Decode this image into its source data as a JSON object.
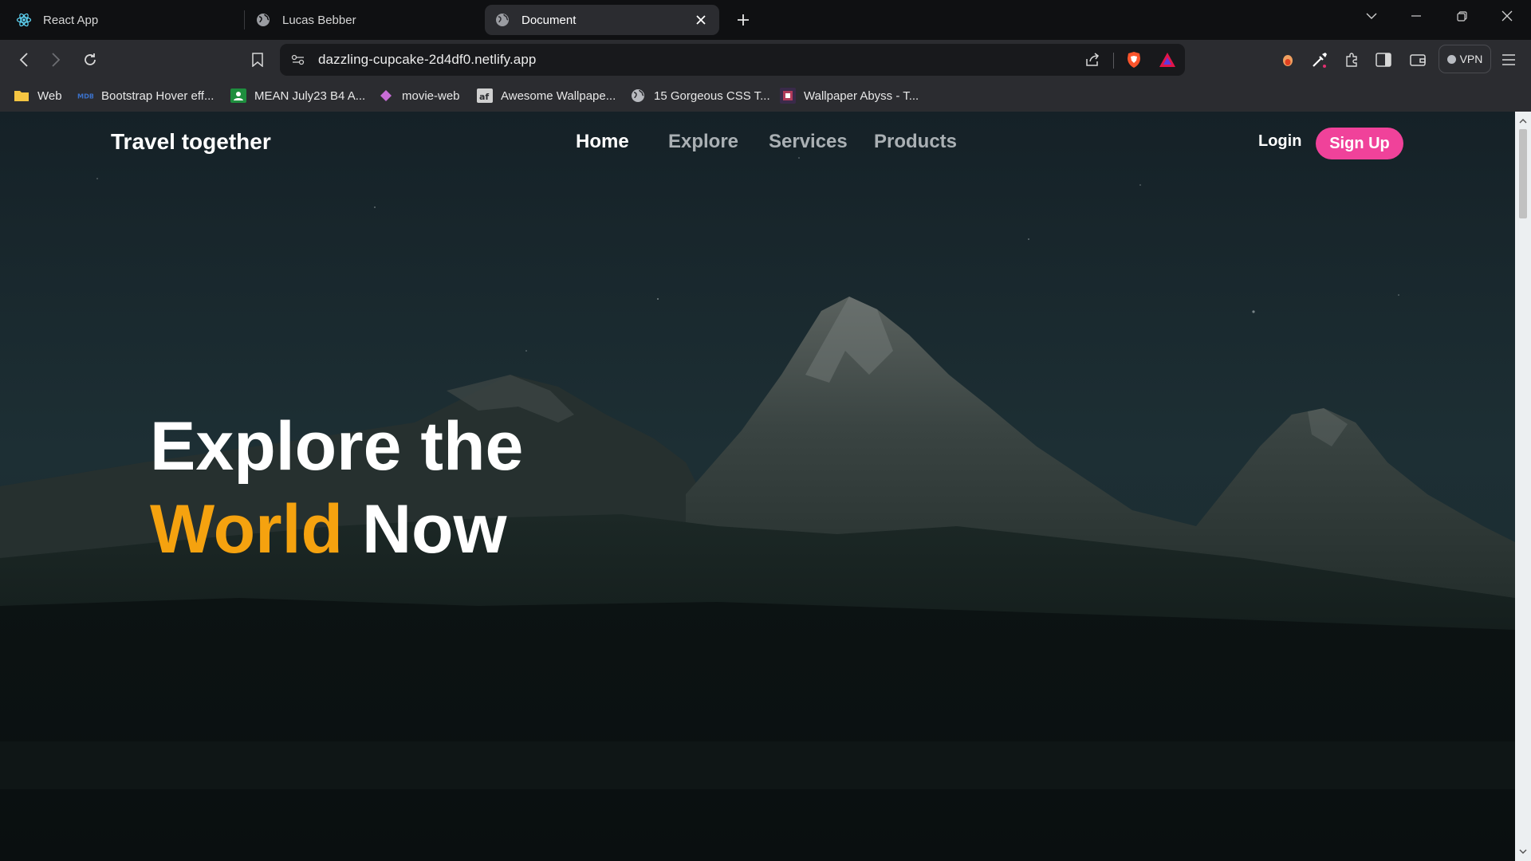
{
  "browser": {
    "tabs": [
      {
        "title": "React App",
        "icon": "react-icon"
      },
      {
        "title": "Lucas Bebber",
        "icon": "globe-icon"
      },
      {
        "title": "Document",
        "icon": "globe-icon",
        "active": true
      }
    ],
    "url": "dazzling-cupcake-2d4df0.netlify.app",
    "vpn_label": "VPN",
    "bookmarks": [
      {
        "label": "Web",
        "icon": "folder-icon"
      },
      {
        "label": "Bootstrap Hover eff...",
        "icon": "mdb-icon"
      },
      {
        "label": "MEAN July23 B4 A...",
        "icon": "classroom-icon"
      },
      {
        "label": "movie-web",
        "icon": "diamond-icon"
      },
      {
        "label": "Awesome Wallpape...",
        "icon": "wallpaper-icon"
      },
      {
        "label": "15 Gorgeous CSS T...",
        "icon": "globe-icon"
      },
      {
        "label": "Wallpaper Abyss - T...",
        "icon": "abyss-icon"
      }
    ]
  },
  "page": {
    "logo": "Travel together",
    "nav": {
      "home": "Home",
      "explore": "Explore",
      "services": "Services",
      "products": "Products"
    },
    "login": "Login",
    "signup": "Sign Up",
    "hero": {
      "line1": "Explore the",
      "accent": "World",
      "rest": "Now"
    }
  },
  "colors": {
    "accent": "#f5a20f",
    "signup": "#f0429a",
    "brave": "#fb542b"
  }
}
